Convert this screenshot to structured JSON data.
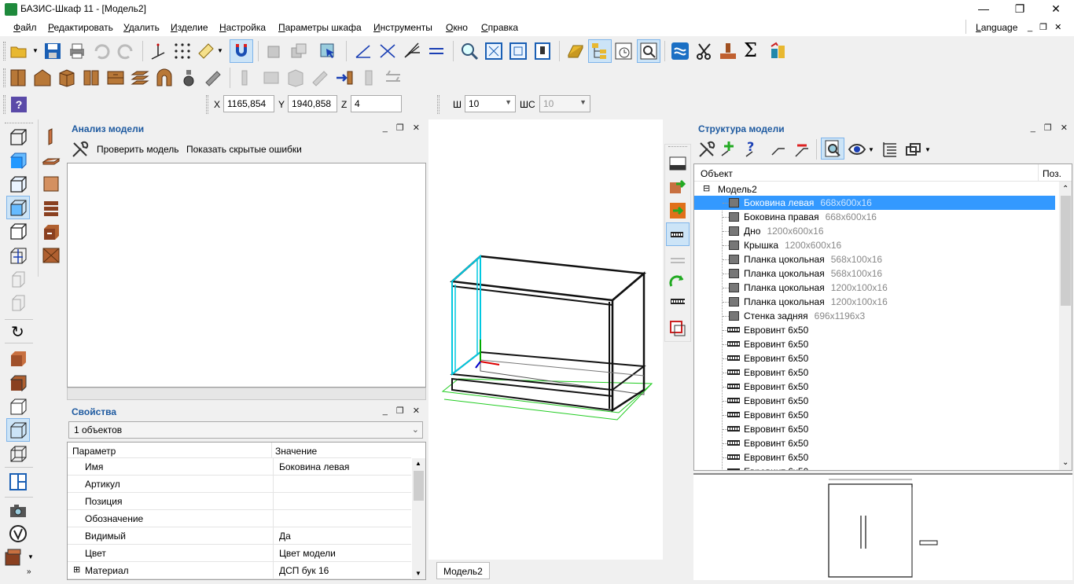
{
  "window": {
    "title": "БАЗИС-Шкаф 11 - [Модель2]",
    "minimize": "—",
    "maximize": "❐",
    "close": "✕"
  },
  "menu": {
    "items": [
      "Файл",
      "Редактировать",
      "Удалить",
      "Изделие",
      "Настройка",
      "Параметры шкафа",
      "Инструменты",
      "Окно",
      "Справка"
    ],
    "language": "Language",
    "mdi_controls": "_ ❐ ✕"
  },
  "coords": {
    "x_label": "X",
    "x_value": "1165,854",
    "y_label": "Y",
    "y_value": "1940,858",
    "z_label": "Z",
    "z_value": "4",
    "w_label": "Ш",
    "w_value": "10",
    "ws_label": "ШС",
    "ws_value": "10"
  },
  "analysis": {
    "title": "Анализ модели",
    "check": "Проверить модель",
    "show_hidden": "Показать скрытые ошибки"
  },
  "properties": {
    "title": "Свойства",
    "selector": "1 объектов",
    "col_param": "Параметр",
    "col_value": "Значение",
    "rows": [
      {
        "name": "Имя",
        "value": "Боковина левая"
      },
      {
        "name": "Артикул",
        "value": ""
      },
      {
        "name": "Позиция",
        "value": ""
      },
      {
        "name": "Обозначение",
        "value": ""
      },
      {
        "name": "Видимый",
        "value": "Да"
      },
      {
        "name": "Цвет",
        "value": "Цвет модели"
      },
      {
        "name": "Материал",
        "value": "ДСП бук 16",
        "expand": "⊞"
      }
    ]
  },
  "viewport": {
    "tab": "Модель2"
  },
  "structure": {
    "title": "Структура модели",
    "col_object": "Объект",
    "col_pos": "Поз.",
    "root": "Модель2",
    "root_toggle": "⊟",
    "items": [
      {
        "name": "Боковина левая",
        "dim": "668x600x16",
        "kind": "panel",
        "selected": true
      },
      {
        "name": "Боковина правая",
        "dim": "668x600x16",
        "kind": "panel"
      },
      {
        "name": "Дно",
        "dim": "1200x600x16",
        "kind": "panel"
      },
      {
        "name": "Крышка",
        "dim": "1200x600x16",
        "kind": "panel"
      },
      {
        "name": "Планка цокольная",
        "dim": "568x100x16",
        "kind": "panel"
      },
      {
        "name": "Планка цокольная",
        "dim": "568x100x16",
        "kind": "panel"
      },
      {
        "name": "Планка цокольная",
        "dim": "1200x100x16",
        "kind": "panel"
      },
      {
        "name": "Планка цокольная",
        "dim": "1200x100x16",
        "kind": "panel"
      },
      {
        "name": "Стенка задняя",
        "dim": "696x1196x3",
        "kind": "panel"
      },
      {
        "name": "Евровинт 6х50",
        "dim": "",
        "kind": "screw"
      },
      {
        "name": "Евровинт 6х50",
        "dim": "",
        "kind": "screw"
      },
      {
        "name": "Евровинт 6х50",
        "dim": "",
        "kind": "screw"
      },
      {
        "name": "Евровинт 6х50",
        "dim": "",
        "kind": "screw"
      },
      {
        "name": "Евровинт 6х50",
        "dim": "",
        "kind": "screw"
      },
      {
        "name": "Евровинт 6х50",
        "dim": "",
        "kind": "screw"
      },
      {
        "name": "Евровинт 6х50",
        "dim": "",
        "kind": "screw"
      },
      {
        "name": "Евровинт 6х50",
        "dim": "",
        "kind": "screw"
      },
      {
        "name": "Евровинт 6х50",
        "dim": "",
        "kind": "screw"
      },
      {
        "name": "Евровинт 6х50",
        "dim": "",
        "kind": "screw"
      },
      {
        "name": "Евровинт 6х50",
        "dim": "",
        "kind": "screw"
      }
    ]
  },
  "panel_controls": "_ ❐ ✕",
  "colors": {
    "selection": "#3399ff",
    "panel_title": "#1e5aa0",
    "highlight_edges": "#00c8e0",
    "floor_grid": "#22cc22"
  }
}
